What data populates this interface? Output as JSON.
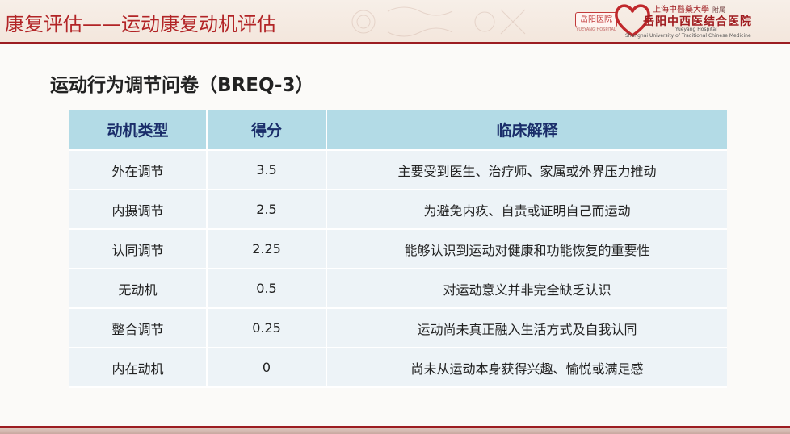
{
  "header": {
    "title": "康复评估——运动康复动机评估"
  },
  "logo": {
    "badge": "岳阳医院",
    "badge_sub": "YUEYANG HOSPITAL",
    "top_text": "上海中醫藥大學",
    "top_tag": "附属",
    "main_text": "岳阳中西医结合医院",
    "en_line1": "Yueyang Hospital",
    "en_line2": "Shanghai University of Traditional Chinese Medicine",
    "brand_color": "#a01c20"
  },
  "subtitle": "运动行为调节问卷（BREQ-3）",
  "table": {
    "headers": [
      "动机类型",
      "得分",
      "临床解释"
    ],
    "rows": [
      {
        "type": "外在调节",
        "score": "3.5",
        "interpretation": "主要受到医生、治疗师、家属或外界压力推动"
      },
      {
        "type": "内摄调节",
        "score": "2.5",
        "interpretation": "为避免内疚、自责或证明自己而运动"
      },
      {
        "type": "认同调节",
        "score": "2.25",
        "interpretation": "能够认识到运动对健康和功能恢复的重要性"
      },
      {
        "type": "无动机",
        "score": "0.5",
        "interpretation": "对运动意义并非完全缺乏认识"
      },
      {
        "type": "整合调节",
        "score": "0.25",
        "interpretation": "运动尚未真正融入生活方式及自我认同"
      },
      {
        "type": "内在动机",
        "score": "0",
        "interpretation": "尚未从运动本身获得兴趣、愉悦或满足感"
      }
    ],
    "header_color": "#b3dbe6",
    "row_color": "#edf3f7"
  }
}
